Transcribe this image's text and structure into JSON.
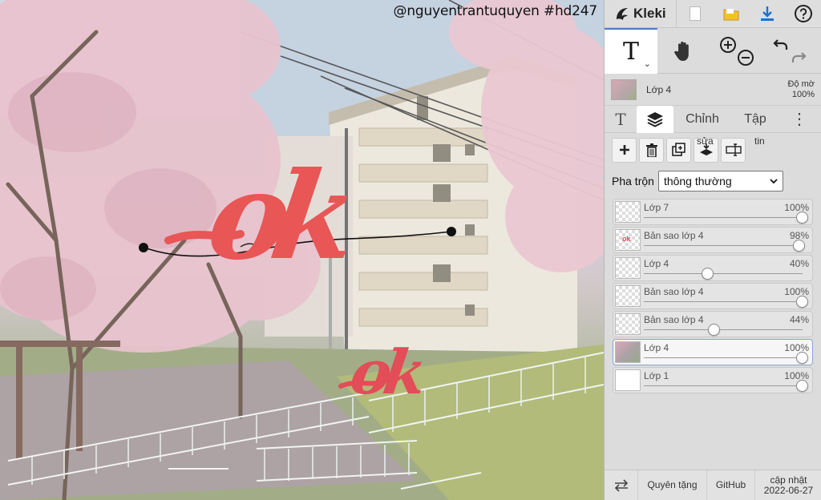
{
  "canvas": {
    "watermark": "@nguyentrantuquyen #hd247",
    "big_text": "ok",
    "small_text": "ok"
  },
  "app": {
    "logo_text": "Kleki"
  },
  "topbar": {
    "icons": [
      "new-image-icon",
      "open-folder-icon",
      "download-icon",
      "help-icon"
    ]
  },
  "colors": {
    "accent": "#4a7ec2",
    "text_red": "#e85656",
    "download_blue": "#1a73d1",
    "folder_yellow": "#f2c12e"
  },
  "layer_header": {
    "name": "Lớp 4",
    "opacity_label": "Độ mờ",
    "opacity_value": "100%"
  },
  "tabs": {
    "adjust": "Chỉnh",
    "file": "Tập"
  },
  "actions": {
    "edit_label": "sửa",
    "info_label": "tin"
  },
  "blend": {
    "label": "Pha trộn",
    "value": "thông thường"
  },
  "layers": [
    {
      "name": "Lớp 7",
      "opacity": "100%",
      "level": 1.0,
      "thumb": "checker",
      "selected": false
    },
    {
      "name": "Bản sao lớp 4",
      "opacity": "98%",
      "level": 0.98,
      "thumb": "checker-red",
      "selected": false
    },
    {
      "name": "Lớp 4",
      "opacity": "40%",
      "level": 0.4,
      "thumb": "checker",
      "selected": false
    },
    {
      "name": "Bản sao lớp 4",
      "opacity": "100%",
      "level": 1.0,
      "thumb": "checker",
      "selected": false
    },
    {
      "name": "Bản sao lớp 4",
      "opacity": "44%",
      "level": 0.44,
      "thumb": "checker",
      "selected": false
    },
    {
      "name": "Lớp 4",
      "opacity": "100%",
      "level": 1.0,
      "thumb": "photo",
      "selected": true
    },
    {
      "name": "Lớp 1",
      "opacity": "100%",
      "level": 1.0,
      "thumb": "white",
      "selected": false
    }
  ],
  "footer": {
    "donate": "Quyên tặng",
    "github": "GitHub",
    "updated_label": "cập nhật",
    "updated_date": "2022-06-27"
  }
}
